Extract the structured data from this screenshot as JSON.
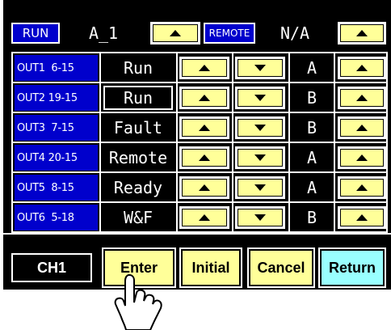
{
  "header": {
    "run_label": "RUN",
    "program_name": "A_1",
    "remote_label": "REMOTE",
    "remote_value": "N/A"
  },
  "outputs": [
    {
      "label": "OUT1  6-15",
      "mode": "Run",
      "channel": "A",
      "selected": false
    },
    {
      "label": "OUT2 19-15",
      "mode": "Run",
      "channel": "B",
      "selected": true
    },
    {
      "label": "OUT3  7-15",
      "mode": "Fault",
      "channel": "B",
      "selected": false
    },
    {
      "label": "OUT4 20-15",
      "mode": "Remote",
      "channel": "A",
      "selected": false
    },
    {
      "label": "OUT5  8-15",
      "mode": "Ready",
      "channel": "A",
      "selected": false
    },
    {
      "label": "OUT6  5-18",
      "mode": "W&F",
      "channel": "B",
      "selected": false
    }
  ],
  "footer": {
    "channel": "CH1",
    "enter_label": "Enter",
    "initial_label": "Initial",
    "cancel_label": "Cancel",
    "return_label": "Return"
  },
  "icons": {
    "up": "triangle-up",
    "down": "triangle-down",
    "cursor": "pointing-hand"
  },
  "colors": {
    "panel_bg": "#000000",
    "label_blue": "#0000cc",
    "button_yellow": "#ffff99",
    "return_cyan": "#99ffff"
  }
}
